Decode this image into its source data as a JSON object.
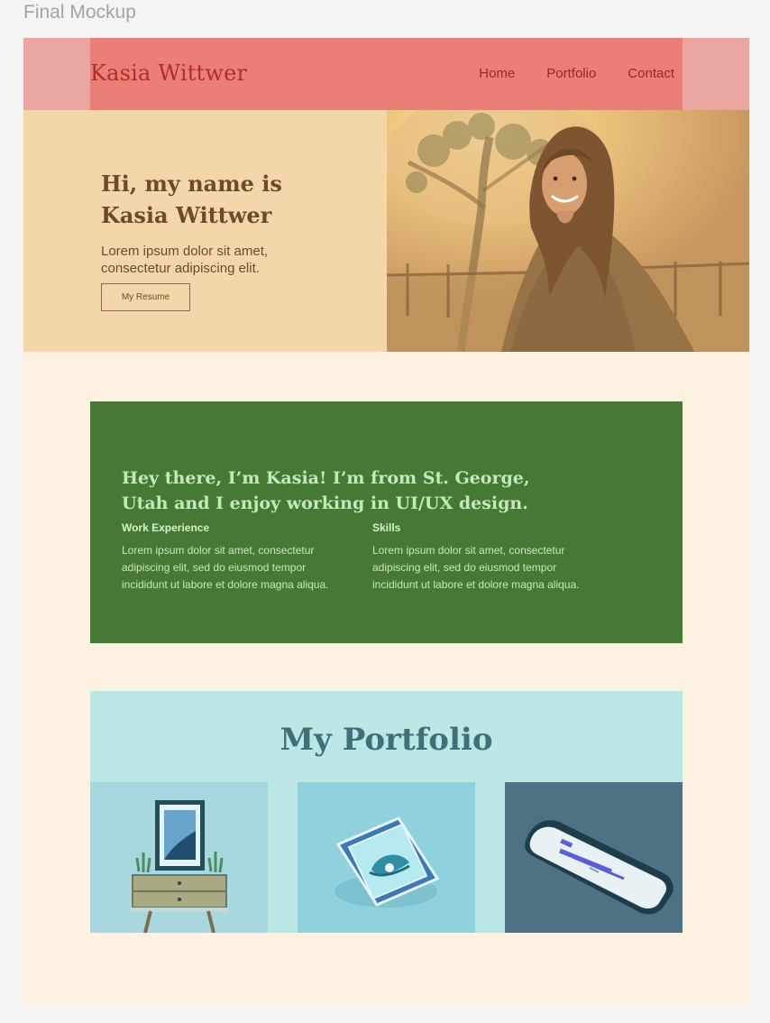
{
  "canvas": {
    "label": "Final Mockup"
  },
  "header": {
    "logo": "Kasia Wittwer",
    "nav": [
      {
        "label": "Home"
      },
      {
        "label": "Portfolio"
      },
      {
        "label": "Contact"
      }
    ]
  },
  "hero": {
    "title": "Hi, my name is Kasia Wittwer",
    "text": "Lorem ipsum dolor sit amet, consectetur adipiscing elit.",
    "button": "My Resume"
  },
  "about": {
    "heading": "Hey there, I’m Kasia! I’m from St. George, Utah and I enjoy working in UI/UX design.",
    "columns": [
      {
        "title": "Work Experience",
        "text": "Lorem ipsum dolor sit amet, consectetur adipiscing elit, sed do eiusmod tempor incididunt ut labore et dolore magna aliqua."
      },
      {
        "title": "Skills",
        "text": "Lorem ipsum dolor sit amet, consectetur adipiscing elit, sed do eiusmod tempor incididunt ut labore et dolore magna aliqua."
      }
    ]
  },
  "portfolio": {
    "title": "My Portfolio"
  },
  "colors": {
    "page_background": "#fdf2e1",
    "header": "#e97f76",
    "hero": "#f2d8a8",
    "about": "#477936",
    "portfolio": "#bde7e5"
  }
}
